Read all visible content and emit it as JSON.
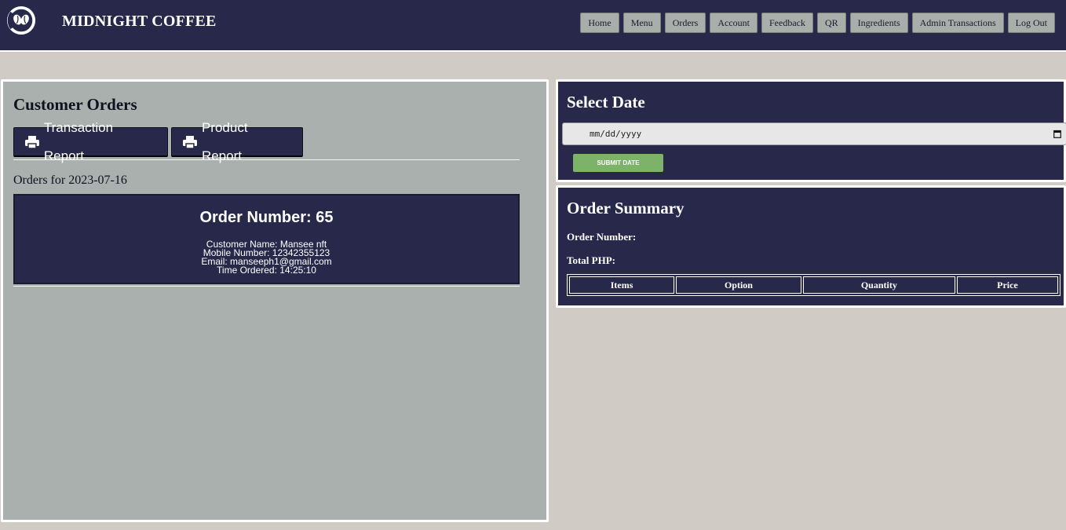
{
  "header": {
    "brand": "MIDNIGHT COFFEE",
    "nav": [
      "Home",
      "Menu",
      "Orders",
      "Account",
      "Feedback",
      "QR",
      "Ingredients",
      "Admin Transactions",
      "Log Out"
    ]
  },
  "left": {
    "title": "Customer Orders",
    "transaction_report_label": "Transaction Report",
    "product_report_label": "Product Report",
    "orders_for": "Orders for 2023-07-16",
    "order": {
      "number_label": "Order Number: 65",
      "customer_name": "Customer Name: Mansee nft",
      "mobile": "Mobile Number: 12342355123",
      "email": "Email: manseeph1@gmail.com",
      "time": "Time Ordered: 14:25:10"
    }
  },
  "date_panel": {
    "title": "Select Date",
    "date_placeholder": "mm/dd/yyyy",
    "submit_label": "SUBMIT DATE"
  },
  "summary": {
    "title": "Order Summary",
    "order_number_label": "Order Number:",
    "total_label": "Total PHP:",
    "columns": [
      "Items",
      "Option",
      "Quantity",
      "Price"
    ]
  },
  "colors": {
    "navy": "#28284a",
    "panel_gray": "#aab0ad",
    "page_bg": "#d0cbc4",
    "submit_green": "#7db269"
  },
  "icons": [
    "coffee-bean-logo-icon",
    "printer-icon",
    "calendar-icon"
  ]
}
